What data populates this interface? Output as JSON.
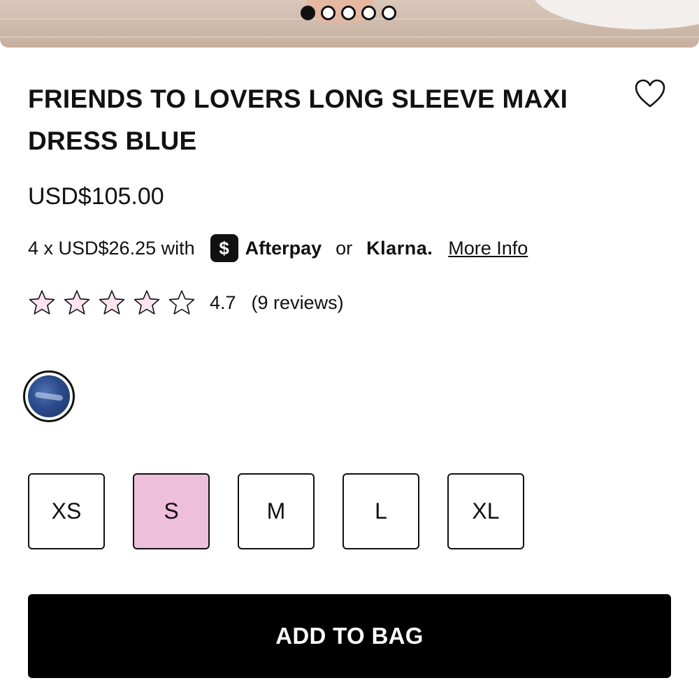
{
  "gallery": {
    "dot_count": 5,
    "active_index": 0
  },
  "product": {
    "title": "FRIENDS TO LOVERS LONG SLEEVE MAXI DRESS BLUE",
    "price": "USD$105.00"
  },
  "installments": {
    "text": "4 x USD$26.25 with",
    "afterpay_icon_glyph": "$",
    "afterpay_label": "Afterpay",
    "or_label": "or",
    "klarna_label": "Klarna.",
    "more_info_label": "More Info"
  },
  "rating": {
    "stars_total": 5,
    "stars_filled": 4,
    "score": "4.7",
    "reviews_label": "(9 reviews)",
    "star_fill_color": "#fbe3ef"
  },
  "color": {
    "swatch_name": "blue-swatch",
    "swatch_color": "#2b4b8c"
  },
  "sizes": {
    "options": [
      "XS",
      "S",
      "M",
      "L",
      "XL"
    ],
    "selected": "S",
    "selected_color": "#eebfd8"
  },
  "actions": {
    "add_to_bag_label": "ADD TO BAG"
  },
  "icons": {
    "wishlist": "heart-icon",
    "star": "star-icon",
    "afterpay": "afterpay-logo-icon"
  }
}
